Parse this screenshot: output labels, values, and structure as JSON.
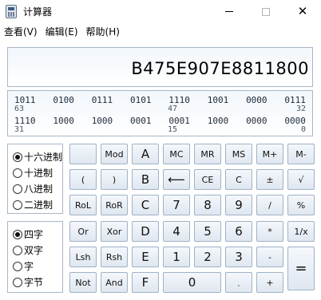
{
  "window": {
    "title": "计算器",
    "icons": {
      "app": "calculator-icon",
      "min": "minimize-icon",
      "max": "maximize-icon",
      "close": "close-icon"
    },
    "close_glyph": "✕"
  },
  "menu": {
    "items": [
      "查看(V)",
      "编辑(E)",
      "帮助(H)"
    ]
  },
  "display": {
    "value": "B475E907E8811800"
  },
  "bits": {
    "row1": [
      "1011",
      "0100",
      "0111",
      "0101",
      "1110",
      "1001",
      "0000",
      "0111"
    ],
    "row1_pos": [
      "63",
      "47",
      "32"
    ],
    "row2": [
      "1110",
      "1000",
      "1000",
      "0001",
      "0001",
      "1000",
      "0000",
      "0000"
    ],
    "row2_pos": [
      "31",
      "15",
      "0"
    ]
  },
  "base_modes": [
    {
      "label": "十六进制",
      "checked": true
    },
    {
      "label": "十进制",
      "checked": false
    },
    {
      "label": "八进制",
      "checked": false
    },
    {
      "label": "二进制",
      "checked": false
    }
  ],
  "word_sizes": [
    {
      "label": "四字",
      "checked": true
    },
    {
      "label": "双字",
      "checked": false
    },
    {
      "label": "字",
      "checked": false
    },
    {
      "label": "字节",
      "checked": false
    }
  ],
  "keys": {
    "blank": "",
    "mod": "Mod",
    "a": "A",
    "mc": "MC",
    "mr": "MR",
    "ms": "MS",
    "mplus": "M+",
    "mminus": "M-",
    "lparen": "(",
    "rparen": ")",
    "b": "B",
    "back": "⟵",
    "ce": "CE",
    "c": "C",
    "plusminus": "±",
    "sqrt": "√",
    "rol": "RoL",
    "ror": "RoR",
    "c_hex": "C",
    "seven": "7",
    "eight": "8",
    "nine": "9",
    "div": "/",
    "percent": "%",
    "or": "Or",
    "xor": "Xor",
    "d": "D",
    "four": "4",
    "five": "5",
    "six": "6",
    "mul": "*",
    "recip": "1/x",
    "lsh": "Lsh",
    "rsh": "Rsh",
    "e": "E",
    "one": "1",
    "two": "2",
    "three": "3",
    "minus": "-",
    "equals": "=",
    "not": "Not",
    "and": "And",
    "f": "F",
    "zero": "0",
    "dot": ".",
    "plus": "+"
  }
}
